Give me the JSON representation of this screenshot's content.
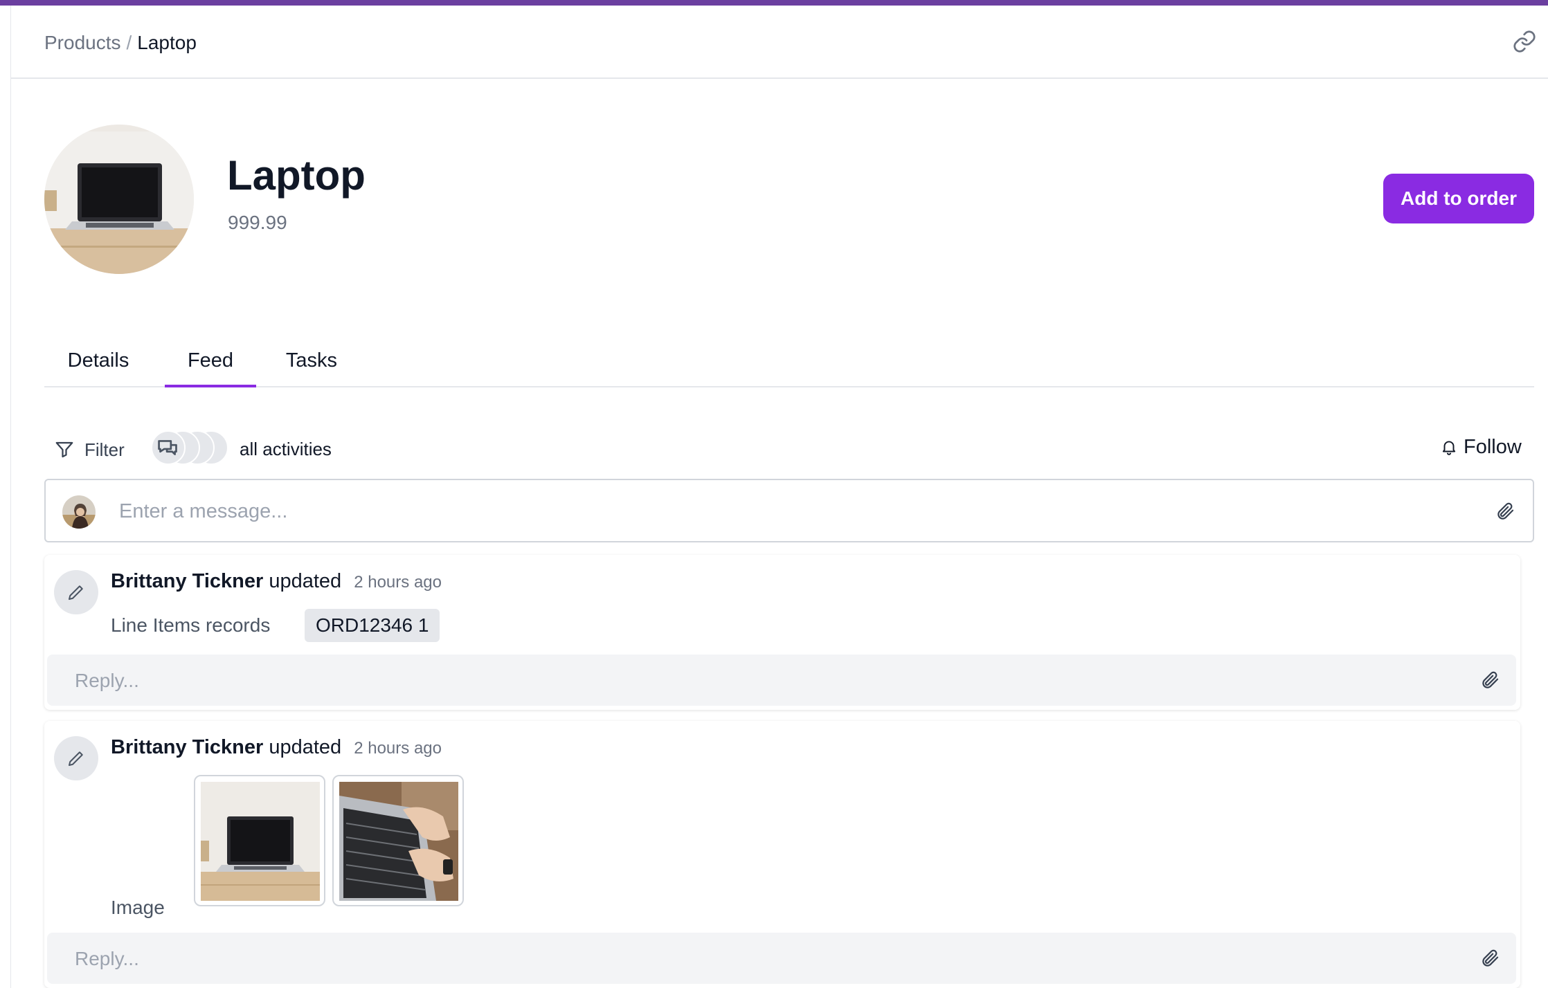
{
  "breadcrumb": {
    "parent": "Products",
    "separator": "/",
    "current": "Laptop"
  },
  "product": {
    "name": "Laptop",
    "price": "999.99"
  },
  "actions": {
    "add_to_order": "Add to order"
  },
  "tabs": [
    {
      "label": "Details",
      "active": false
    },
    {
      "label": "Feed",
      "active": true
    },
    {
      "label": "Tasks",
      "active": false
    }
  ],
  "feed_toolbar": {
    "filter_label": "Filter",
    "activities_label": "all activities",
    "follow_label": "Follow"
  },
  "composer": {
    "placeholder": "Enter a message..."
  },
  "feed": [
    {
      "author": "Brittany Tickner",
      "verb": "updated",
      "time": "2 hours ago",
      "field_label": "Line Items records",
      "record": "ORD12346 1",
      "reply_placeholder": "Reply..."
    },
    {
      "author": "Brittany Tickner",
      "verb": "updated",
      "time": "2 hours ago",
      "field_label": "Image",
      "images": [
        "laptop-on-desk",
        "hands-typing-on-laptop"
      ],
      "reply_placeholder": "Reply..."
    }
  ],
  "colors": {
    "accent": "#8a2be2",
    "top_bar": "#6b3fa0"
  }
}
